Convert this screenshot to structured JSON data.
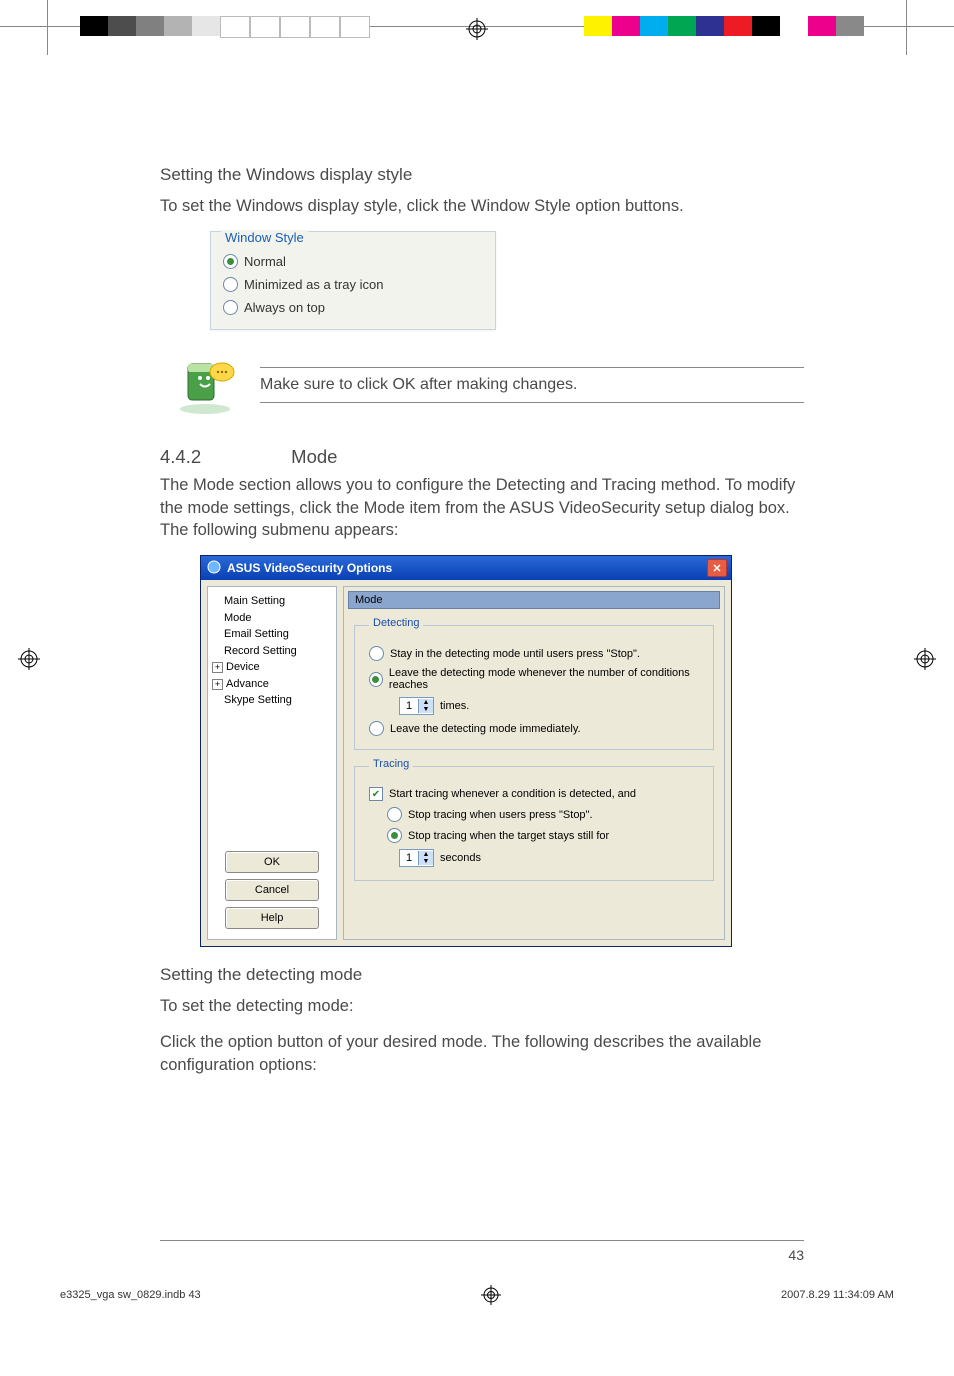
{
  "top_swatches_left": [
    "#000000",
    "#4d4d4d",
    "#808080",
    "#b3b3b3",
    "#e6e6e6",
    "#ffffff",
    "#ffffff",
    "#ffffff",
    "#ffffff",
    "#ffffff"
  ],
  "top_swatches_right": [
    "#fff200",
    "#ec008c",
    "#00aeef",
    "#00a651",
    "#2e3192",
    "#ed1c24",
    "#000000",
    "#ffffff",
    "#ec008c",
    "#898989"
  ],
  "section1": {
    "heading": "Setting the Windows display style",
    "para": "To set the Windows display style, click the Window Style option buttons."
  },
  "ws_group": {
    "legend": "Window Style",
    "opt1": "Normal",
    "opt2": "Minimized as a tray icon",
    "opt3": "Always on top"
  },
  "note_text": "Make sure to click OK after making changes.",
  "sec_num": "4.4.2",
  "sec_title": "Mode",
  "mode_para": "The Mode section allows you to configure the Detecting and Tracing method. To modify the mode settings, click the Mode item from the ASUS VideoSecurity setup dialog box. The following submenu appears:",
  "dialog": {
    "title": "ASUS VideoSecurity Options",
    "tree": [
      "Main Setting",
      "Mode",
      "Email Setting",
      "Record Setting",
      "Device",
      "Advance",
      "Skype Setting"
    ],
    "buttons": {
      "ok": "OK",
      "cancel": "Cancel",
      "help": "Help"
    },
    "mode_label": "Mode",
    "detecting": {
      "legend": "Detecting",
      "opt1": "Stay in the detecting mode until users press \"Stop\".",
      "opt2": "Leave the detecting mode whenever the number of conditions reaches",
      "spin1": "1",
      "times": "times.",
      "opt3": "Leave the detecting mode immediately."
    },
    "tracing": {
      "legend": "Tracing",
      "chk": "Start tracing whenever a condition is detected,  and",
      "opt1": "Stop tracing when users press \"Stop\".",
      "opt2": "Stop tracing when the target stays still for",
      "spin": "1",
      "seconds": "seconds"
    }
  },
  "section3": {
    "heading": "Setting the detecting mode",
    "para1": "To set the detecting mode:",
    "para2": "Click the option button of your desired mode. The following describes the available configuration options:"
  },
  "page_number": "43",
  "footer_file": "e3325_vga sw_0829.indb   43",
  "footer_date": "2007.8.29   11:34:09 AM"
}
